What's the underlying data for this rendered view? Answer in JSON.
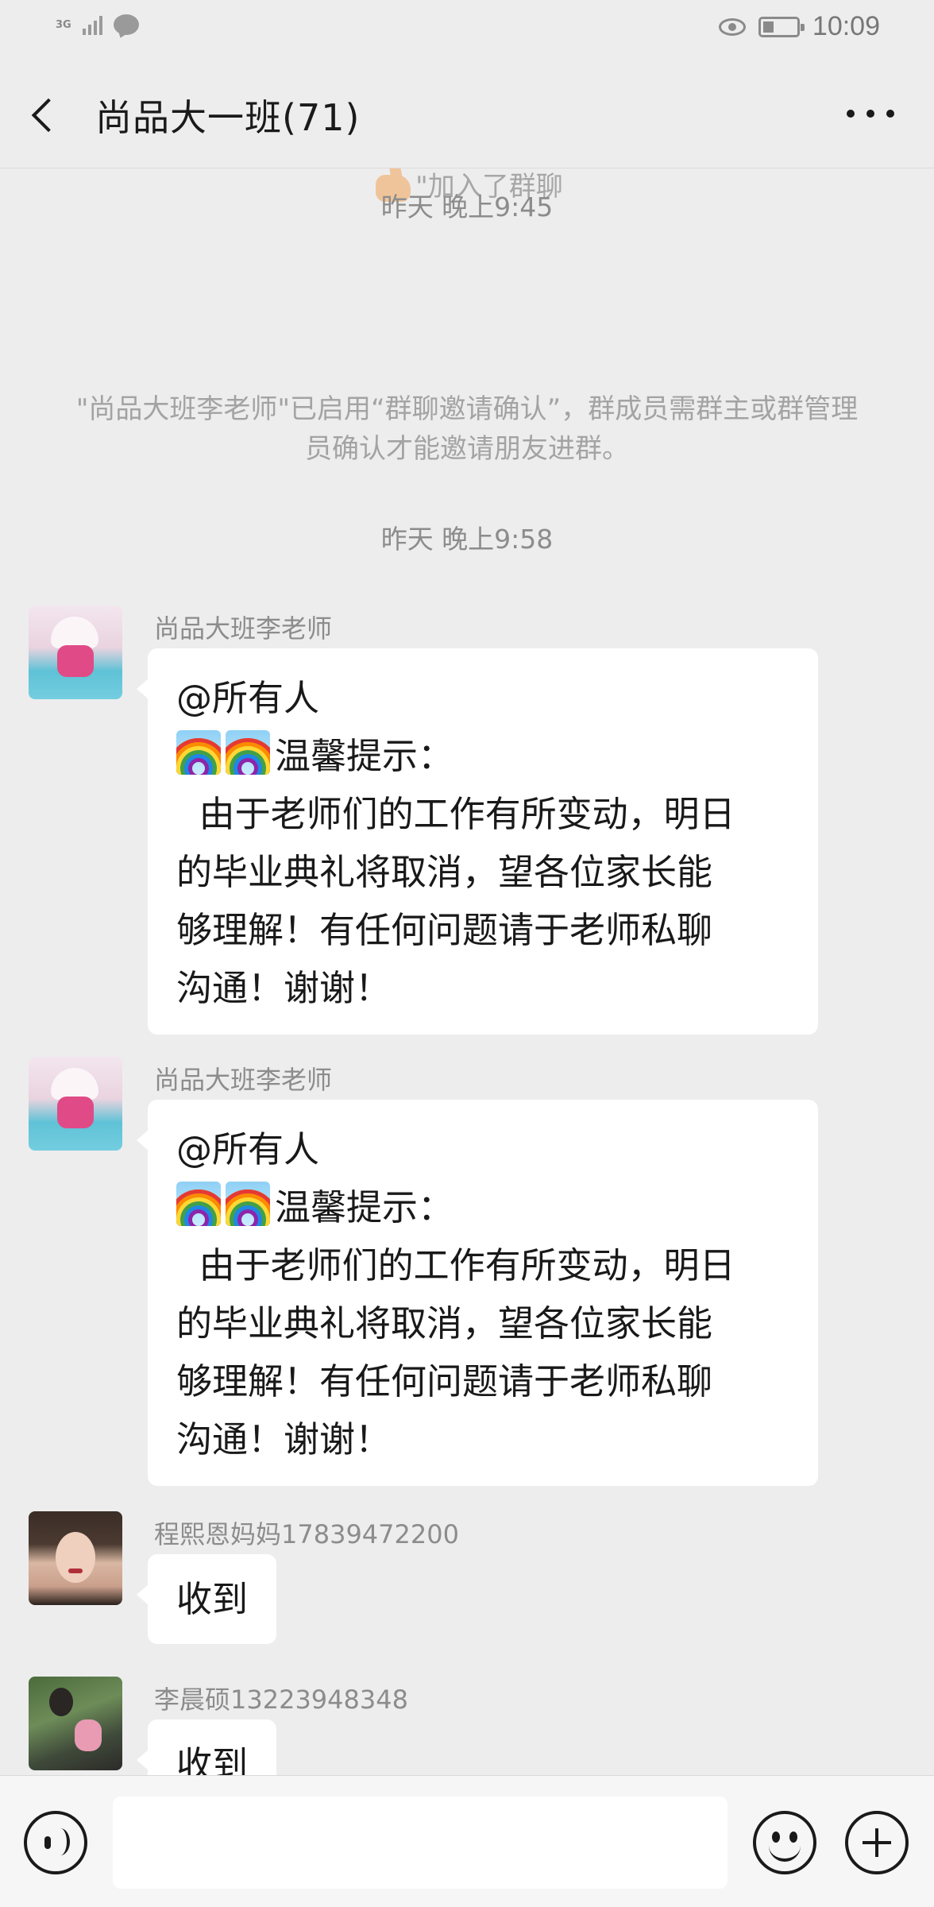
{
  "status_bar": {
    "network": "3G",
    "time": "10:09"
  },
  "header": {
    "title": "尚品大一班(71)"
  },
  "chat": {
    "system_join": "\"加入了群聊",
    "timestamp_1": "昨天 晚上9:45",
    "system_notice": "\"尚品大班李老师\"已启用“群聊邀请确认”，群成员需群主或群管理员确认才能邀请朋友进群。",
    "timestamp_2": "昨天 晚上9:58",
    "messages": [
      {
        "sender": "尚品大班李老师",
        "lines": [
          "@所有人",
          "温馨提示：",
          "  由于老师们的工作有所变动，明日",
          "的毕业典礼将取消，望各位家长能",
          "够理解！有任何问题请于老师私聊",
          "沟通！谢谢！"
        ],
        "emoji": "rainbow"
      },
      {
        "sender": "尚品大班李老师",
        "lines": [
          "@所有人",
          "温馨提示：",
          "  由于老师们的工作有所变动，明日",
          "的毕业典礼将取消，望各位家长能",
          "够理解！有任何问题请于老师私聊",
          "沟通！谢谢！"
        ],
        "emoji": "rainbow"
      },
      {
        "sender": "程熙恩妈妈17839472200",
        "text": "收到"
      },
      {
        "sender": "李晨硕13223948348",
        "text": "收到"
      }
    ]
  },
  "input_bar": {
    "input_value": "",
    "icons": [
      "voice-icon",
      "emoji-icon",
      "plus-icon"
    ]
  }
}
